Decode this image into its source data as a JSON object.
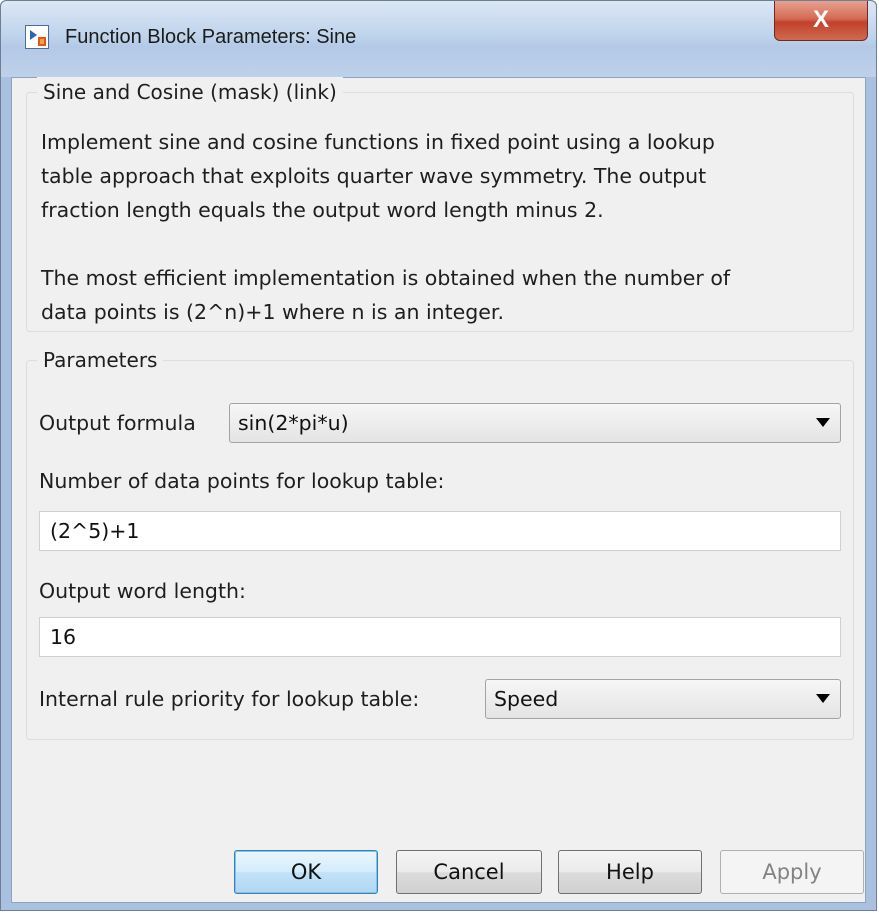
{
  "window": {
    "title": "Function Block Parameters: Sine",
    "close_glyph": "X"
  },
  "description": {
    "legend": "Sine and Cosine (mask) (link)",
    "text": "Implement sine and cosine functions in fixed point using a lookup\ntable approach that exploits quarter wave symmetry. The output\nfraction length equals the output word length minus 2.\n\nThe most efficient implementation is obtained when the number of\ndata points is (2^n)+1 where n is an integer."
  },
  "parameters": {
    "legend": "Parameters",
    "output_formula": {
      "label": "Output formula",
      "value": "sin(2*pi*u)"
    },
    "num_points": {
      "label": "Number of data points for lookup table:",
      "value": "(2^5)+1"
    },
    "word_length": {
      "label": "Output word length:",
      "value": "16"
    },
    "rule_priority": {
      "label": "Internal rule priority for lookup table:",
      "value": "Speed"
    }
  },
  "buttons": {
    "ok": "OK",
    "cancel": "Cancel",
    "help": "Help",
    "apply": "Apply"
  },
  "icons": {
    "app": "simulink-block-icon",
    "close": "close-icon",
    "dropdown": "chevron-down-icon"
  }
}
